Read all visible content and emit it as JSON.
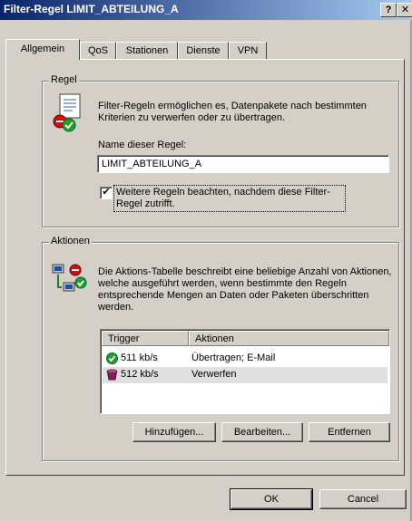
{
  "window": {
    "title": "Filter-Regel LIMIT_ABTEILUNG_A",
    "help_label": "?"
  },
  "tabs": [
    {
      "label": "Allgemein",
      "active": true
    },
    {
      "label": "QoS",
      "active": false
    },
    {
      "label": "Stationen",
      "active": false
    },
    {
      "label": "Dienste",
      "active": false
    },
    {
      "label": "VPN",
      "active": false
    }
  ],
  "rule": {
    "group_label": "Regel",
    "description": "Filter-Regeln ermöglichen es, Datenpakete nach bestimmten Kriterien zu verwerfen oder zu übertragen.",
    "name_label": "Name dieser Regel:",
    "name_value": "LIMIT_ABTEILUNG_A",
    "checkbox_label": "Weitere Regeln beachten, nachdem diese Filter-Regel zutrifft.",
    "checkbox_checked": true,
    "checkbox_mark": "✔"
  },
  "actions": {
    "group_label": "Aktionen",
    "description": "Die Aktions-Tabelle beschreibt eine beliebige Anzahl von Aktionen, welche ausgeführt werden, wenn bestimmte den Regeln entsprechende Mengen an Daten oder Paketen überschritten werden.",
    "columns": [
      "Trigger",
      "Aktionen"
    ],
    "rows": [
      {
        "trigger": "511 kb/s",
        "action": "Übertragen; E-Mail",
        "icon": "green-check-icon"
      },
      {
        "trigger": "512 kb/s",
        "action": "Verwerfen",
        "icon": "trash-bin-icon"
      }
    ],
    "buttons": {
      "add": "Hinzufügen...",
      "edit": "Bearbeiten...",
      "remove": "Entfernen"
    }
  },
  "footer": {
    "ok": "OK",
    "cancel": "Cancel"
  },
  "colors": {
    "titlebar_start": "#0a246a",
    "titlebar_end": "#a6caf0",
    "dialog_bg": "#d4d0c8"
  }
}
